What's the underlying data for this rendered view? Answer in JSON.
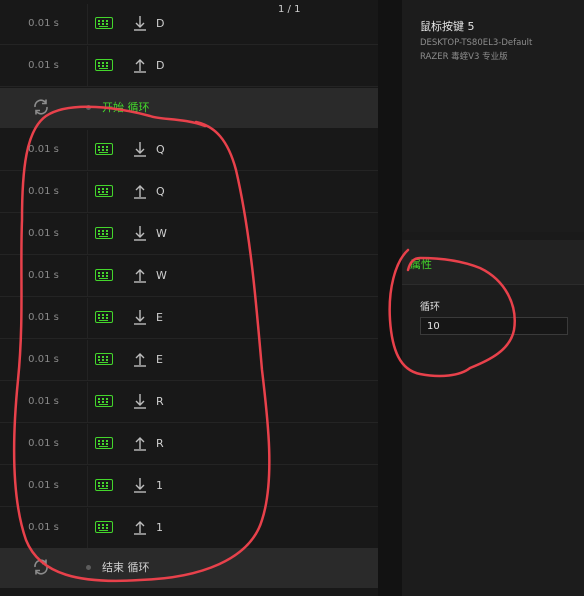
{
  "page_indicator": "1 / 1",
  "macro": {
    "events": [
      {
        "time": "0.01 s",
        "direction": "down",
        "key": "D"
      },
      {
        "time": "0.01 s",
        "direction": "up",
        "key": "D"
      },
      {
        "loop": "start",
        "label": "开始 循环"
      },
      {
        "time": "0.01 s",
        "direction": "down",
        "key": "Q"
      },
      {
        "time": "0.01 s",
        "direction": "up",
        "key": "Q"
      },
      {
        "time": "0.01 s",
        "direction": "down",
        "key": "W"
      },
      {
        "time": "0.01 s",
        "direction": "up",
        "key": "W"
      },
      {
        "time": "0.01 s",
        "direction": "down",
        "key": "E"
      },
      {
        "time": "0.01 s",
        "direction": "up",
        "key": "E"
      },
      {
        "time": "0.01 s",
        "direction": "down",
        "key": "R"
      },
      {
        "time": "0.01 s",
        "direction": "up",
        "key": "R"
      },
      {
        "time": "0.01 s",
        "direction": "down",
        "key": "1"
      },
      {
        "time": "0.01 s",
        "direction": "up",
        "key": "1"
      },
      {
        "loop": "end",
        "label": "结束 循环"
      }
    ]
  },
  "device": {
    "title": "鼠标按键 5",
    "profile": "DESKTOP-TS80EL3-Default",
    "model": "RAZER 毒蝰V3 专业版"
  },
  "properties": {
    "title": "属性",
    "loop_label": "循环",
    "loop_count": "10"
  },
  "colors": {
    "accent": "#44d62c",
    "annotation": "#e8414b"
  }
}
